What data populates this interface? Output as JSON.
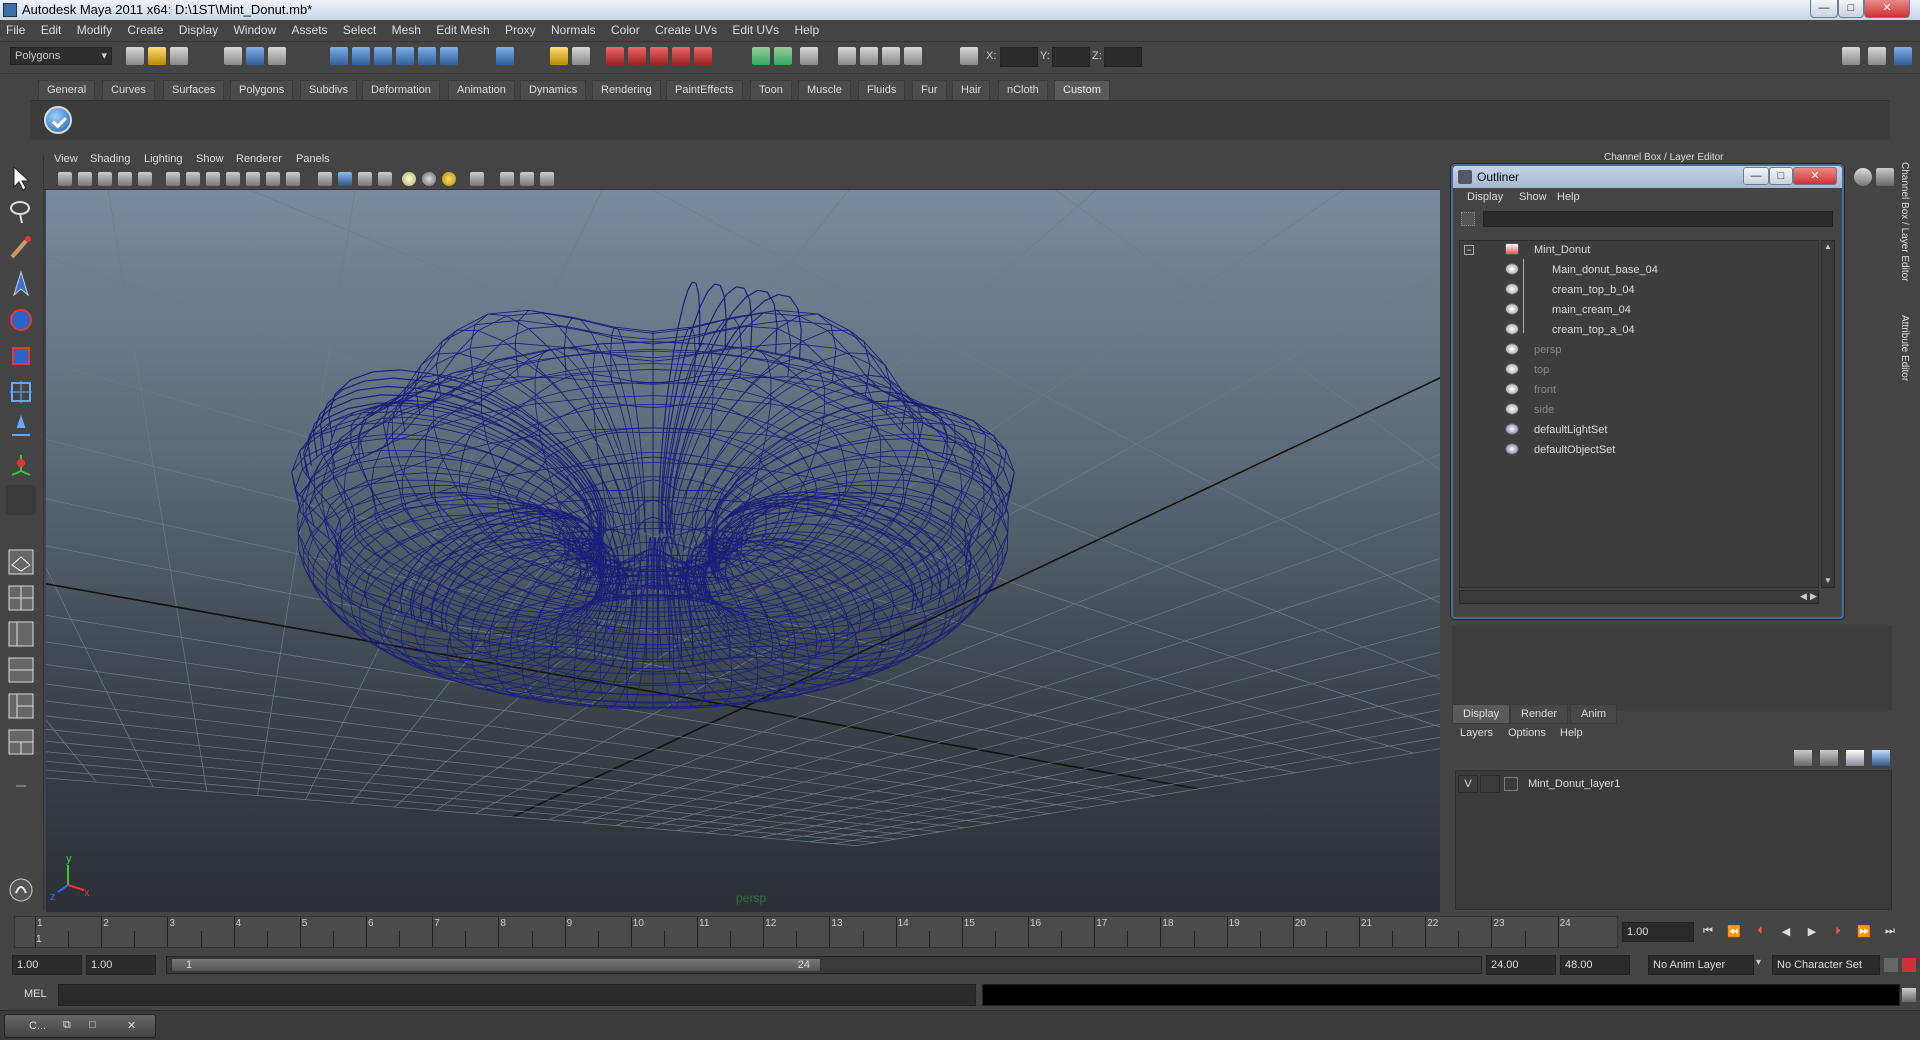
{
  "window": {
    "title": "Autodesk Maya 2011 x64: D:\\1ST\\Mint_Donut.mb*",
    "minimize": "—",
    "maximize": "□",
    "close": "✕"
  },
  "menubar": [
    "File",
    "Edit",
    "Modify",
    "Create",
    "Display",
    "Window",
    "Assets",
    "Select",
    "Mesh",
    "Edit Mesh",
    "Proxy",
    "Normals",
    "Color",
    "Create UVs",
    "Edit UVs",
    "Help"
  ],
  "status": {
    "mode": "Polygons",
    "x_label": "X:",
    "y_label": "Y:",
    "z_label": "Z:"
  },
  "shelf": {
    "tabs": [
      "General",
      "Curves",
      "Surfaces",
      "Polygons",
      "Subdivs",
      "Deformation",
      "Animation",
      "Dynamics",
      "Rendering",
      "PaintEffects",
      "Toon",
      "Muscle",
      "Fluids",
      "Fur",
      "Hair",
      "nCloth",
      "Custom"
    ],
    "active": "Custom"
  },
  "viewport": {
    "menu": [
      "View",
      "Shading",
      "Lighting",
      "Show",
      "Renderer",
      "Panels"
    ],
    "camera_label": "persp",
    "axis_x": "x",
    "axis_y": "y",
    "axis_z": "z",
    "wire_color": "#1a1f7a"
  },
  "channel_box": {
    "header": "Channel Box / Layer Editor"
  },
  "outliner": {
    "title": "Outliner",
    "menu": [
      "Display",
      "Show",
      "Help"
    ],
    "items": [
      {
        "label": "Mint_Donut",
        "indent": 0
      },
      {
        "label": "Main_donut_base_04",
        "indent": 1
      },
      {
        "label": "cream_top_b_04",
        "indent": 1
      },
      {
        "label": "main_cream_04",
        "indent": 1
      },
      {
        "label": "cream_top_a_04",
        "indent": 1
      },
      {
        "label": "persp",
        "indent": 0
      },
      {
        "label": "top",
        "indent": 0
      },
      {
        "label": "front",
        "indent": 0
      },
      {
        "label": "side",
        "indent": 0
      },
      {
        "label": "defaultLightSet",
        "indent": 0
      },
      {
        "label": "defaultObjectSet",
        "indent": 0
      }
    ]
  },
  "layer_editor": {
    "tabs": [
      "Display",
      "Render",
      "Anim"
    ],
    "active_tab": "Display",
    "menu": [
      "Layers",
      "Options",
      "Help"
    ],
    "layer_visibility": "V",
    "layer_name": "Mint_Donut_layer1"
  },
  "side_tabs": [
    "Channel Box / Layer Editor",
    "Attribute Editor"
  ],
  "timeline": {
    "frames": [
      "1",
      "2",
      "3",
      "4",
      "5",
      "6",
      "7",
      "8",
      "9",
      "10",
      "11",
      "12",
      "13",
      "14",
      "15",
      "16",
      "17",
      "18",
      "19",
      "20",
      "21",
      "22",
      "23",
      "24"
    ],
    "current_marker": "1",
    "current_frame": "1.00"
  },
  "range": {
    "start": "1.00",
    "anim_start": "1.00",
    "handle_start": "1",
    "handle_end": "24",
    "end": "24.00",
    "anim_end": "48.00",
    "anim_layer": "No Anim Layer",
    "character_set": "No Character Set"
  },
  "command": {
    "label": "MEL"
  },
  "taskbar": {
    "item": "C..."
  }
}
